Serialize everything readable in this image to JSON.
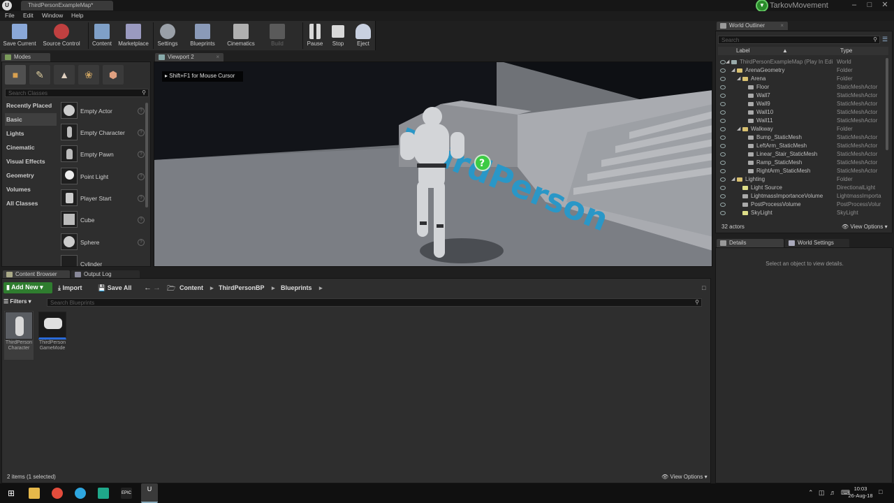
{
  "window": {
    "doc_tab": "ThirdPersonExampleMap*",
    "project": "TarkovMovement"
  },
  "menu": [
    "File",
    "Edit",
    "Window",
    "Help"
  ],
  "toolbar": [
    {
      "label": "Save Current",
      "icon": "save-icon",
      "color": "#8aa8d8"
    },
    {
      "label": "Source Control",
      "icon": "source-control-icon",
      "color": "#c04040"
    },
    {
      "label": "Content",
      "icon": "content-icon",
      "color": "#7fa0c8"
    },
    {
      "label": "Marketplace",
      "icon": "marketplace-icon",
      "color": "#9a9ac0"
    },
    {
      "label": "Settings",
      "icon": "settings-icon",
      "color": "#9aa0a8"
    },
    {
      "label": "Blueprints",
      "icon": "blueprints-icon",
      "color": "#8a9ab8"
    },
    {
      "label": "Cinematics",
      "icon": "cinematics-icon",
      "color": "#b0b0b0"
    },
    {
      "label": "Build",
      "icon": "build-icon",
      "color": "#5a5a5a"
    },
    {
      "label": "Pause",
      "icon": "pause-icon",
      "color": "#d8d8d8"
    },
    {
      "label": "Stop",
      "icon": "stop-icon",
      "color": "#d8d8d8"
    },
    {
      "label": "Eject",
      "icon": "eject-icon",
      "color": "#c8d0e0"
    }
  ],
  "modes": {
    "tab": "Modes",
    "search_placeholder": "Search Classes",
    "categories": [
      "Recently Placed",
      "Basic",
      "Lights",
      "Cinematic",
      "Visual Effects",
      "Geometry",
      "Volumes",
      "All Classes"
    ],
    "items": [
      "Empty Actor",
      "Empty Character",
      "Empty Pawn",
      "Point Light",
      "Player Start",
      "Cube",
      "Sphere",
      "Cylinder"
    ]
  },
  "viewport": {
    "tab": "Viewport 2",
    "hint": "Shift+F1 for Mouse Cursor",
    "floor_text": "ThirdPerson"
  },
  "outliner": {
    "tab": "World Outliner",
    "search_placeholder": "Search",
    "col_label": "Label",
    "col_type": "Type",
    "rows": [
      {
        "label": "ThirdPersonExampleMap (Play In Edi",
        "type": "World",
        "depth": 1,
        "kind": "world"
      },
      {
        "label": "ArenaGeometry",
        "type": "Folder",
        "depth": 2,
        "kind": "folder"
      },
      {
        "label": "Arena",
        "type": "Folder",
        "depth": 3,
        "kind": "folder"
      },
      {
        "label": "Floor",
        "type": "StaticMeshActor",
        "depth": 4,
        "kind": "mesh"
      },
      {
        "label": "Wall7",
        "type": "StaticMeshActor",
        "depth": 4,
        "kind": "mesh"
      },
      {
        "label": "Wall9",
        "type": "StaticMeshActor",
        "depth": 4,
        "kind": "mesh"
      },
      {
        "label": "Wall10",
        "type": "StaticMeshActor",
        "depth": 4,
        "kind": "mesh"
      },
      {
        "label": "Wall11",
        "type": "StaticMeshActor",
        "depth": 4,
        "kind": "mesh"
      },
      {
        "label": "Walkway",
        "type": "Folder",
        "depth": 3,
        "kind": "folder"
      },
      {
        "label": "Bump_StaticMesh",
        "type": "StaticMeshActor",
        "depth": 4,
        "kind": "mesh"
      },
      {
        "label": "LeftArm_StaticMesh",
        "type": "StaticMeshActor",
        "depth": 4,
        "kind": "mesh"
      },
      {
        "label": "Linear_Stair_StaticMesh",
        "type": "StaticMeshActor",
        "depth": 4,
        "kind": "mesh"
      },
      {
        "label": "Ramp_StaticMesh",
        "type": "StaticMeshActor",
        "depth": 4,
        "kind": "mesh"
      },
      {
        "label": "RightArm_StaticMesh",
        "type": "StaticMeshActor",
        "depth": 4,
        "kind": "mesh"
      },
      {
        "label": "Lighting",
        "type": "Folder",
        "depth": 2,
        "kind": "folder"
      },
      {
        "label": "Light Source",
        "type": "DirectionalLight",
        "depth": 3,
        "kind": "light"
      },
      {
        "label": "LightmassImportanceVolume",
        "type": "LightmassImporta",
        "depth": 3,
        "kind": "volume"
      },
      {
        "label": "PostProcessVolume",
        "type": "PostProcessVolur",
        "depth": 3,
        "kind": "volume"
      },
      {
        "label": "SkyLight",
        "type": "SkyLight",
        "depth": 3,
        "kind": "light"
      }
    ],
    "actor_count": "32 actors",
    "view_options": "View Options"
  },
  "details": {
    "tab": "Details",
    "tab2": "World Settings",
    "empty_msg": "Select an object to view details."
  },
  "content_browser": {
    "tab": "Content Browser",
    "tab2": "Output Log",
    "add_new": "Add New",
    "import": "Import",
    "save_all": "Save All",
    "path": [
      "Content",
      "ThirdPersonBP",
      "Blueprints"
    ],
    "filters": "Filters",
    "search_placeholder": "Search Blueprints",
    "assets": [
      {
        "line1": "ThirdPerson",
        "line2": "Character"
      },
      {
        "line1": "ThirdPerson",
        "line2": "GameMode"
      }
    ],
    "status": "2 items (1 selected)",
    "view_options": "View Options"
  },
  "taskbar": {
    "time": "10:03",
    "date": "26-Aug-18",
    "epic_label": "EPIC"
  }
}
